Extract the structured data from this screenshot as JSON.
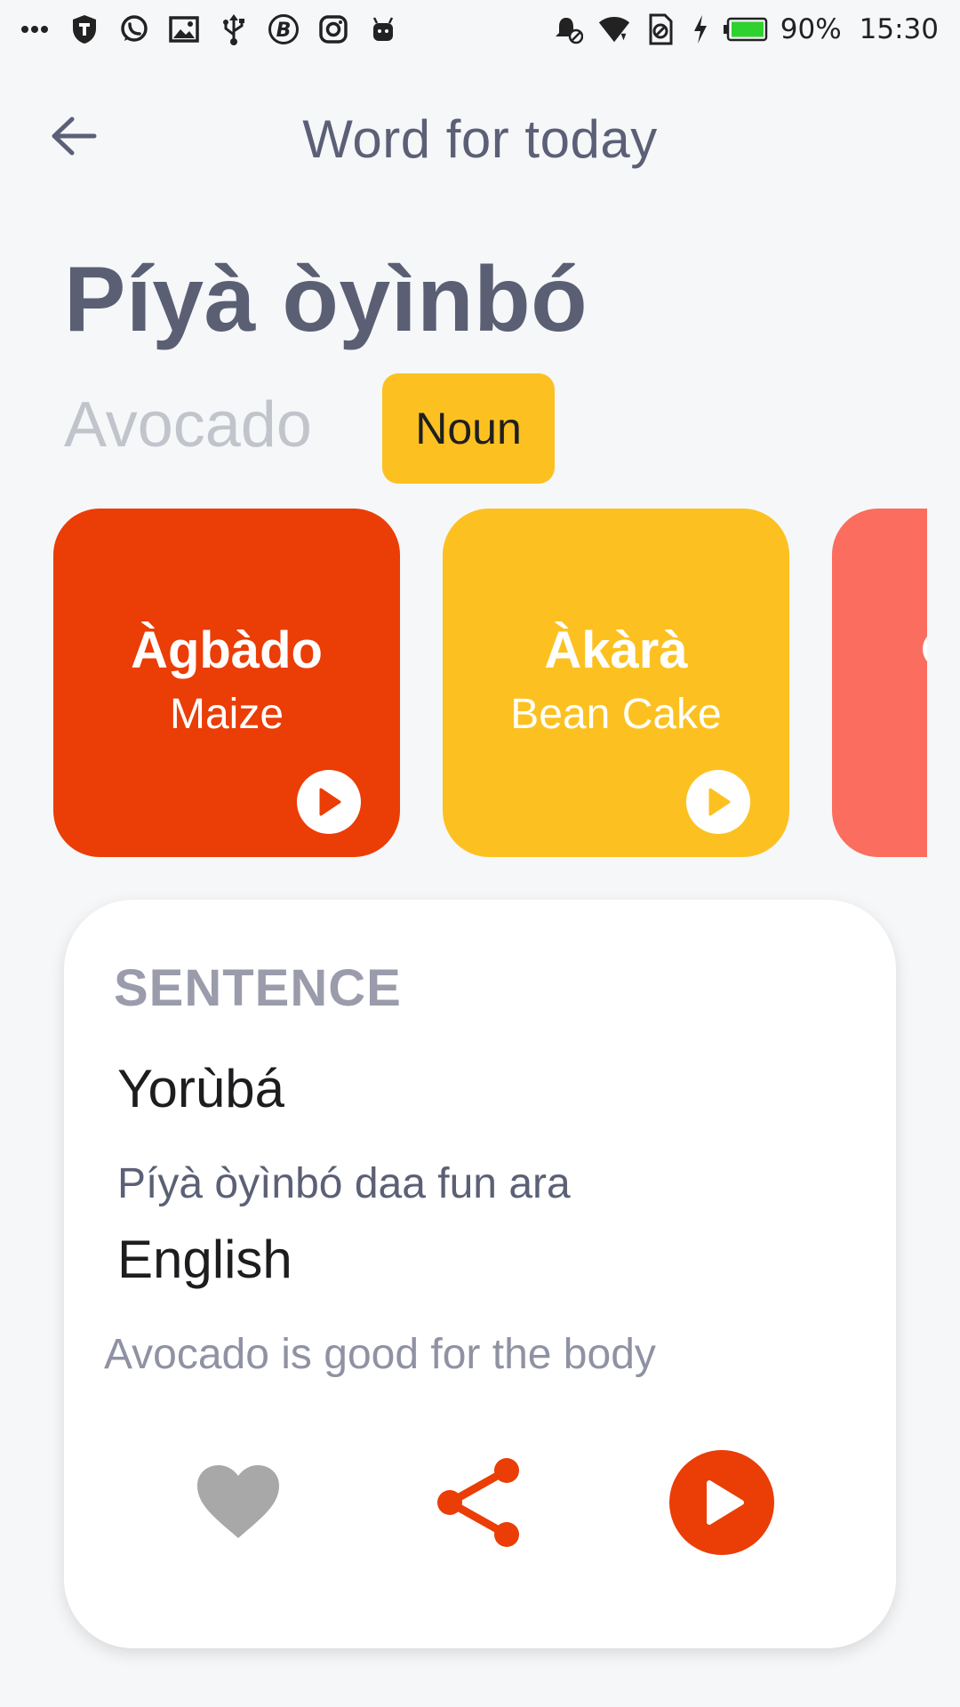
{
  "status_bar": {
    "battery": "90%",
    "time": "15:30"
  },
  "header": {
    "title": "Word for today"
  },
  "word": {
    "yoruba": "Píyà òyìnbó",
    "english": "Avocado",
    "part_of_speech": "Noun"
  },
  "related_words": [
    {
      "yoruba": "Àgbàdo",
      "english": "Maize",
      "color": "#eb3d06"
    },
    {
      "yoruba": "Àkàrà",
      "english": "Bean Cake",
      "color": "#fcc121"
    },
    {
      "yoruba": "",
      "english": "",
      "color": "#fb6d5f"
    }
  ],
  "sentence": {
    "section_label": "SENTENCE",
    "yoruba_label": "Yorùbá",
    "yoruba_text": "Píyà òyìnbó daa fun ara",
    "english_label": "English",
    "english_text": "Avocado is good for the body"
  },
  "colors": {
    "accent": "#eb3d06",
    "badge": "#fcc121",
    "heart": "#a8a8a8"
  }
}
